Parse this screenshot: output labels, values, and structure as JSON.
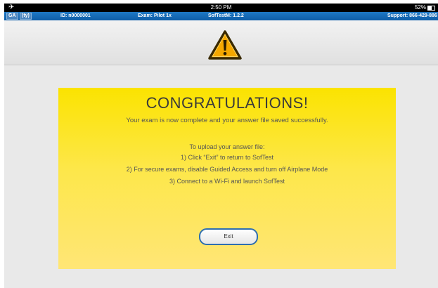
{
  "status_bar": {
    "airplane_icon": "airplane-icon",
    "time": "2:50 PM",
    "battery_percent": "52%",
    "battery_level": 0.52
  },
  "info_bar": {
    "badge1": "GA",
    "badge2": "(ty)",
    "id": "ID: n0000001",
    "exam": "Exam: Pilot 1x",
    "version": "SofTestM: 1.2.2",
    "support": "Support: 866-429-886"
  },
  "header": {
    "icon": "warning-icon",
    "colors": {
      "triangle": "#f5a800",
      "outline": "#3a2a00"
    }
  },
  "panel": {
    "title": "CONGRATULATIONS!",
    "subtitle": "Your exam is now complete and your answer file saved successfully.",
    "instructions_heading": "To upload your answer file:",
    "step1": "1) Click “Exit” to return to SofTest",
    "step2": "2) For secure exams, disable Guided Access and turn off Airplane Mode",
    "step3": "3) Connect to a Wi-Fi and launch SofTest",
    "exit_label": "Exit",
    "colors": {
      "panel_top": "#fbe300",
      "panel_bottom": "#ffe676",
      "button_border": "#2f6fb0"
    }
  }
}
